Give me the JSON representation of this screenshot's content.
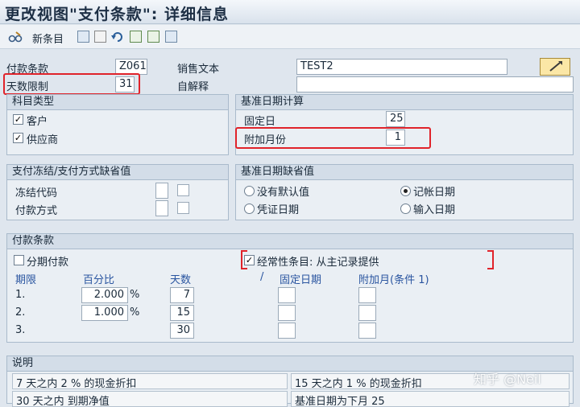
{
  "window": {
    "title": "更改视图\"支付条款\": 详细信息"
  },
  "toolbar": {
    "new_entry_label": "新条目"
  },
  "header": {
    "payment_terms_label": "付款条款",
    "payment_terms_value": "Z061",
    "sales_text_label": "销售文本",
    "sales_text_value": "TEST2",
    "day_limit_label": "天数限制",
    "day_limit_value": "31",
    "own_explanation_label": "自解释",
    "own_explanation_value": ""
  },
  "account_type": {
    "title": "科目类型",
    "customer_label": "客户",
    "customer_checked": "✓",
    "vendor_label": "供应商",
    "vendor_checked": "✓"
  },
  "baseline_calc": {
    "title": "基准日期计算",
    "fixed_day_label": "固定日",
    "fixed_day_value": "25",
    "extra_months_label": "附加月份",
    "extra_months_value": "1"
  },
  "block_defaults": {
    "title": "支付冻结/支付方式缺省值",
    "block_key_label": "冻结代码",
    "payment_method_label": "付款方式"
  },
  "baseline_default": {
    "title": "基准日期缺省值",
    "no_default_label": "没有默认值",
    "posting_date_label": "记帐日期",
    "document_date_label": "凭证日期",
    "entry_date_label": "输入日期"
  },
  "terms": {
    "title": "付款条款",
    "installment_label": "分期付款",
    "recurring_label": "经常性条目: 从主记录提供",
    "recurring_checked": "✓",
    "col_period": "期限",
    "col_percent": "百分比",
    "col_days": "天数",
    "col_slash": "/",
    "col_fixed_date": "固定日期",
    "col_add_months": "附加月(条件 1)",
    "percent_sign": "%",
    "rows": [
      {
        "period": "1.",
        "percent": "2.000",
        "days": "7"
      },
      {
        "period": "2.",
        "percent": "1.000",
        "days": "15"
      },
      {
        "period": "3.",
        "percent": "",
        "days": "30"
      }
    ]
  },
  "explanation": {
    "title": "说明",
    "line1_left": "7 天之内 2 % 的现金折扣",
    "line1_right": "15 天之内 1 % 的现金折扣",
    "line2_left": "30 天之内 到期净值",
    "line2_right": "基准日期为下月 25"
  },
  "watermark": {
    "text": "知乎 @Neil"
  }
}
